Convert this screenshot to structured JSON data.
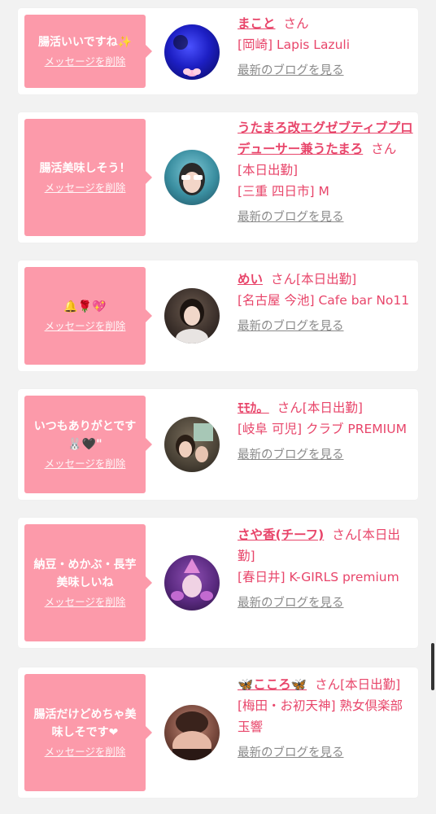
{
  "delete_label": "メッセージを削除",
  "blog_label": "最新のブログを見る",
  "san_label": "さん",
  "status_label": "[本日出勤]",
  "colors": {
    "bubble": "#fc9aaa",
    "accent": "#e8456a",
    "link_gray": "#8a8a8a"
  },
  "items": [
    {
      "message": "腸活いいですね✨",
      "name": "まこと",
      "status": "",
      "shop": "[岡崎] Lapis Lazuli"
    },
    {
      "message": "腸活美味しそう！",
      "name": "うたまろ改エグゼブティブプロデューサー兼うたまろ",
      "status": "[本日出勤]",
      "shop": "[三重 四日市] M"
    },
    {
      "message": "🔔🌹💖",
      "name": "めい",
      "status": "[本日出勤]",
      "shop": "[名古屋 今池] Cafe bar No11"
    },
    {
      "message": "いつもありがとです🐰🖤\"",
      "name": "ﾓﾓｶ。",
      "status": "[本日出勤]",
      "shop": "[岐阜 可児] クラブ PREMIUM"
    },
    {
      "message": "納豆・めかぶ・長芋美味しいね",
      "name": "さや香(チーフ)",
      "status": "[本日出勤]",
      "shop": "[春日井] K-GIRLS premium"
    },
    {
      "message": "腸活だけどめちゃ美味しそです❤",
      "name": "🦋こころ🦋",
      "status": "[本日出勤]",
      "shop": "[梅田・お初天神] 熟女倶楽部 玉響"
    }
  ]
}
